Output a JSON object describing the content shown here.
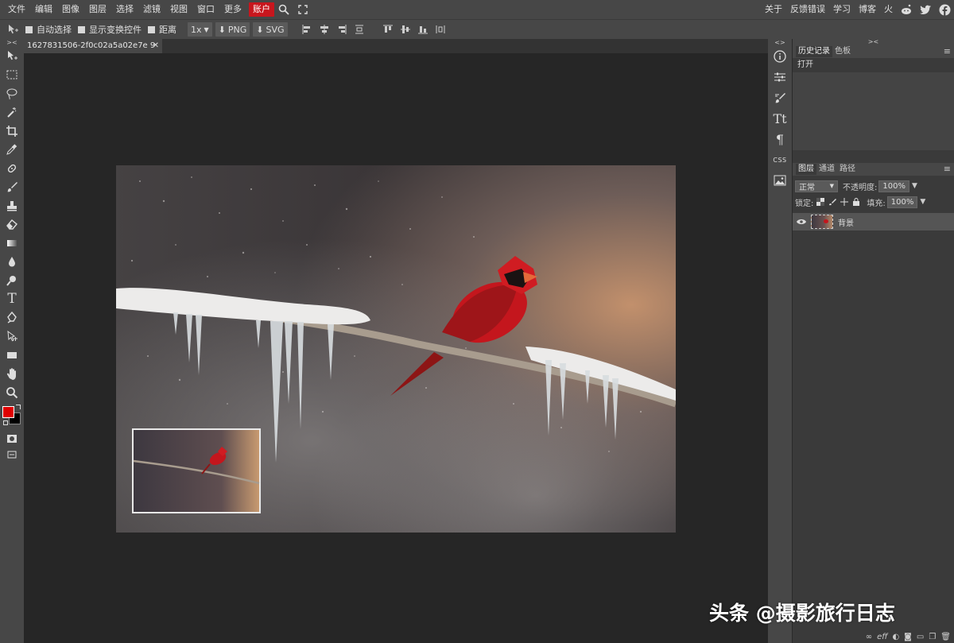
{
  "menu": {
    "items": [
      "文件",
      "编辑",
      "图像",
      "图层",
      "选择",
      "滤镜",
      "视图",
      "窗口",
      "更多"
    ],
    "account": "账户",
    "right_items": [
      "关于",
      "反馈错误",
      "学习",
      "博客",
      "火"
    ]
  },
  "options": {
    "auto_select": "自动选择",
    "show_transform": "显示变换控件",
    "distance": "距离",
    "zoom": "1x",
    "png": "PNG",
    "svg": "SVG"
  },
  "document": {
    "tab_title": "1627831506-2f0c02a5a02e7e 9",
    "close": "✕"
  },
  "history_panel": {
    "tabs": [
      "历史记录",
      "色板"
    ],
    "items": [
      "打开"
    ]
  },
  "layers_panel": {
    "tabs": [
      "图层",
      "通道",
      "路径"
    ],
    "blend_mode": "正常",
    "opacity_label": "不透明度:",
    "opacity_value": "100%",
    "lock_label": "锁定:",
    "fill_label": "填充:",
    "fill_value": "100%",
    "layers": [
      {
        "name": "背景"
      }
    ]
  },
  "strip_icons": [
    "info-icon",
    "adjustments-icon",
    "brush-settings-icon",
    "character-icon",
    "paragraph-icon",
    "css-icon",
    "image-icon"
  ],
  "watermark": "头条 @摄影旅行日志",
  "colors": {
    "accent": "#c8161d",
    "foreground": "#e00000",
    "background": "#000000"
  }
}
